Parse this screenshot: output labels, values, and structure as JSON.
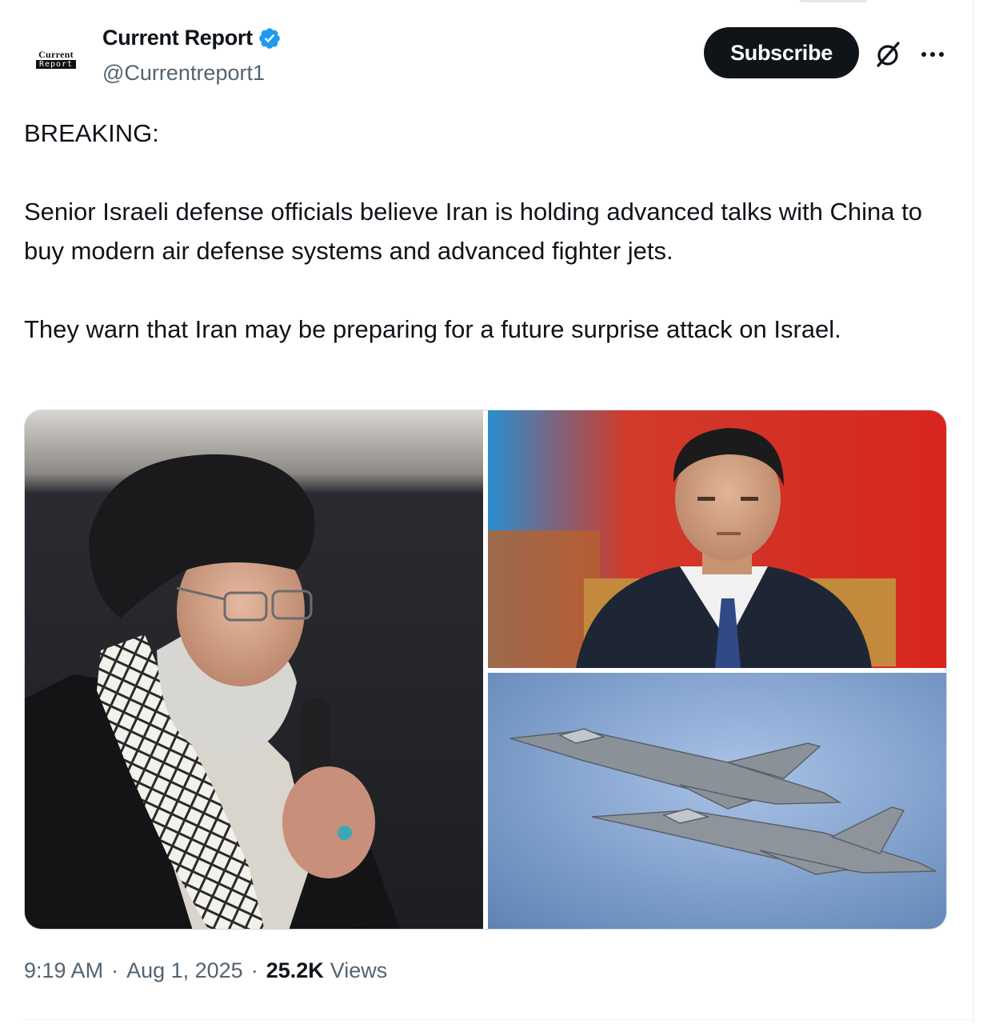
{
  "tweet": {
    "display_name": "Current Report",
    "handle": "@Currentreport1",
    "verified": true,
    "avatar_text": {
      "top": "Current",
      "bottom": "Report"
    },
    "paragraphs": [
      "BREAKING:",
      "Senior Israeli defense officials believe Iran is holding advanced talks with China to buy modern air defense systems and advanced fighter jets.",
      "They warn that Iran may be preparing for a future surprise attack on Israel."
    ],
    "time": "9:19 AM",
    "date": "Aug 1, 2025",
    "views_count": "25.2K",
    "views_label": "Views",
    "separator": "·"
  },
  "actions": {
    "subscribe_label": "Subscribe",
    "grok_icon": "grok-icon",
    "more_icon": "more-horizontal-icon"
  },
  "colors": {
    "text": "#0f1419",
    "secondary": "#536471",
    "verified": "#1d9bf0",
    "button": "#0f1419"
  }
}
